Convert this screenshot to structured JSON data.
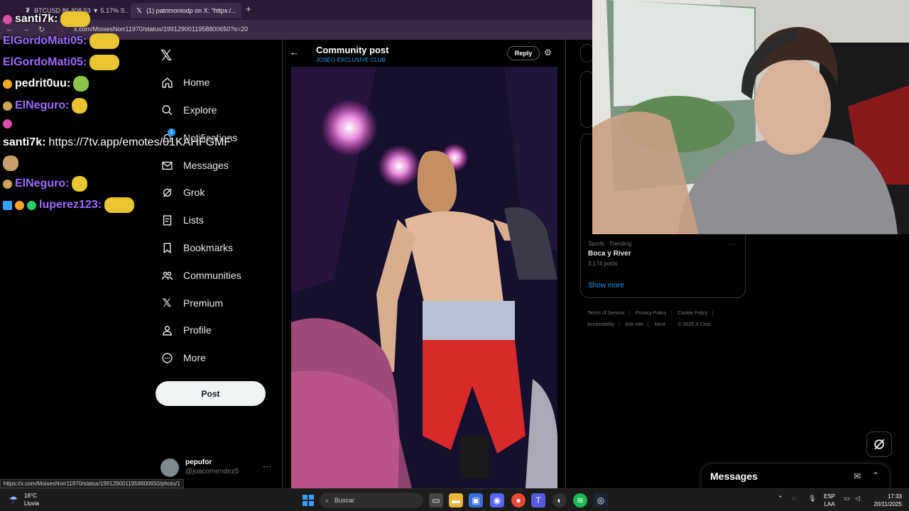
{
  "browser": {
    "tabs": [
      {
        "label": "BTCUSD 86,808.53 ▼ 5.17% S..."
      },
      {
        "label": "(1) patrimoniodp on X: \"https:/..."
      }
    ],
    "url": "x.com/MoisesNorr11970/status/1991290011958800650?s=20",
    "status_link": "https://x.com/MoisesNorr11970/status/1991290011958800650/photo/1"
  },
  "sidebar": {
    "items": [
      {
        "label": "Home",
        "icon": "home-icon"
      },
      {
        "label": "Explore",
        "icon": "search-icon"
      },
      {
        "label": "Notifications",
        "icon": "bell-icon",
        "badge": "1"
      },
      {
        "label": "Messages",
        "icon": "mail-icon"
      },
      {
        "label": "Grok",
        "icon": "grok-icon"
      },
      {
        "label": "Lists",
        "icon": "list-icon"
      },
      {
        "label": "Bookmarks",
        "icon": "bookmark-icon"
      },
      {
        "label": "Communities",
        "icon": "communities-icon"
      },
      {
        "label": "Premium",
        "icon": "x-logo-icon"
      },
      {
        "label": "Profile",
        "icon": "profile-icon"
      },
      {
        "label": "More",
        "icon": "more-circle-icon"
      }
    ],
    "post_label": "Post",
    "account": {
      "name": "pepufor",
      "handle": "@joacomendez5"
    }
  },
  "post": {
    "title": "Community post",
    "community": "JOSEO EXCLUSIVE CLUB",
    "reply_label": "Reply"
  },
  "right": {
    "trend": {
      "meta": "Sports · Trending",
      "name": "Boca y River",
      "posts": "3,174 posts"
    },
    "show_more": "Show more",
    "footer": [
      "Terms of Service",
      "Privacy Policy",
      "Cookie Policy",
      "Accessibility",
      "Ads info",
      "More ···",
      "© 2025 X Corp."
    ]
  },
  "messages": {
    "title": "Messages"
  },
  "chat": [
    {
      "user": "santi7k:",
      "color": "#ffffff",
      "msg": ""
    },
    {
      "user": "ElGordoMati05:",
      "color": "#9b6bff",
      "msg": ""
    },
    {
      "user": "ElGordoMati05:",
      "color": "#9b6bff",
      "msg": ""
    },
    {
      "user": "pedrit0uu:",
      "color": "#ffffff",
      "msg": ""
    },
    {
      "user": "ElNeguro:",
      "color": "#9b6bff",
      "msg": ""
    },
    {
      "user": "",
      "color": "#ffffff",
      "msg": ""
    },
    {
      "user": "santi7k:",
      "color": "#ffffff",
      "msg": "https://7tv.app/emotes/01KAHFGMF"
    },
    {
      "user": "",
      "color": "#ffffff",
      "msg": ""
    },
    {
      "user": "ElNeguro:",
      "color": "#9b6bff",
      "msg": ""
    },
    {
      "user": "luperez123:",
      "color": "#9b6bff",
      "msg": ""
    }
  ],
  "taskbar": {
    "weather_temp": "16°C",
    "weather_desc": "Lluvia",
    "search_placeholder": "Buscar",
    "lang_top": "ESP",
    "lang_bottom": "LAA",
    "time": "17:33",
    "date": "20/11/2025"
  }
}
